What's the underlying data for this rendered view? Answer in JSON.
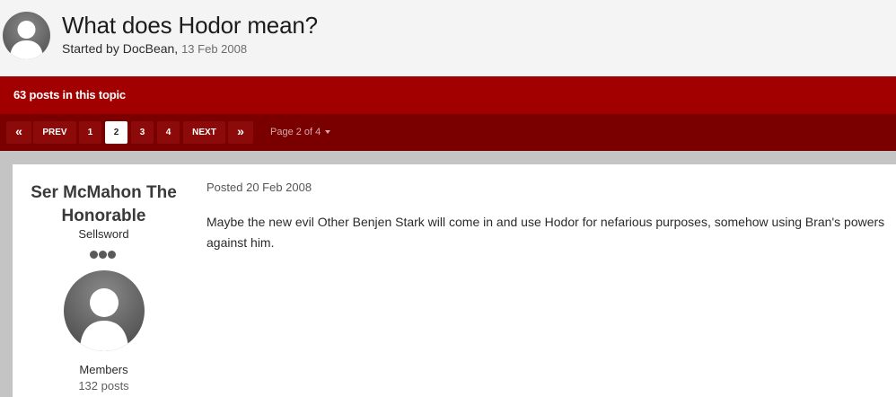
{
  "topic": {
    "title": "What does Hodor mean?",
    "started_by_prefix": "Started by ",
    "author": "DocBean,",
    "date": "13 Feb 2008",
    "avatar_icon": "default-user-avatar-icon"
  },
  "post_count_label": "63 posts in this topic",
  "pagination": {
    "first_icon": "«",
    "prev_label": "PREV",
    "pages": [
      "1",
      "2",
      "3",
      "4"
    ],
    "current_page": "2",
    "next_label": "NEXT",
    "last_icon": "»",
    "page_info": "Page 2 of 4"
  },
  "post": {
    "author_name": "Ser McMahon The Honorable",
    "author_rank": "Sellsword",
    "rank_pips": 3,
    "author_group": "Members",
    "author_posts": "132 posts",
    "posted": "Posted 20 Feb 2008",
    "body": "Maybe the new evil Other Benjen Stark will come in and use Hodor for nefarious purposes, somehow using Bran's powers against him."
  },
  "colors": {
    "header_red": "#a20000",
    "pager_red": "#7a0000",
    "background": "#f4f4f4"
  }
}
